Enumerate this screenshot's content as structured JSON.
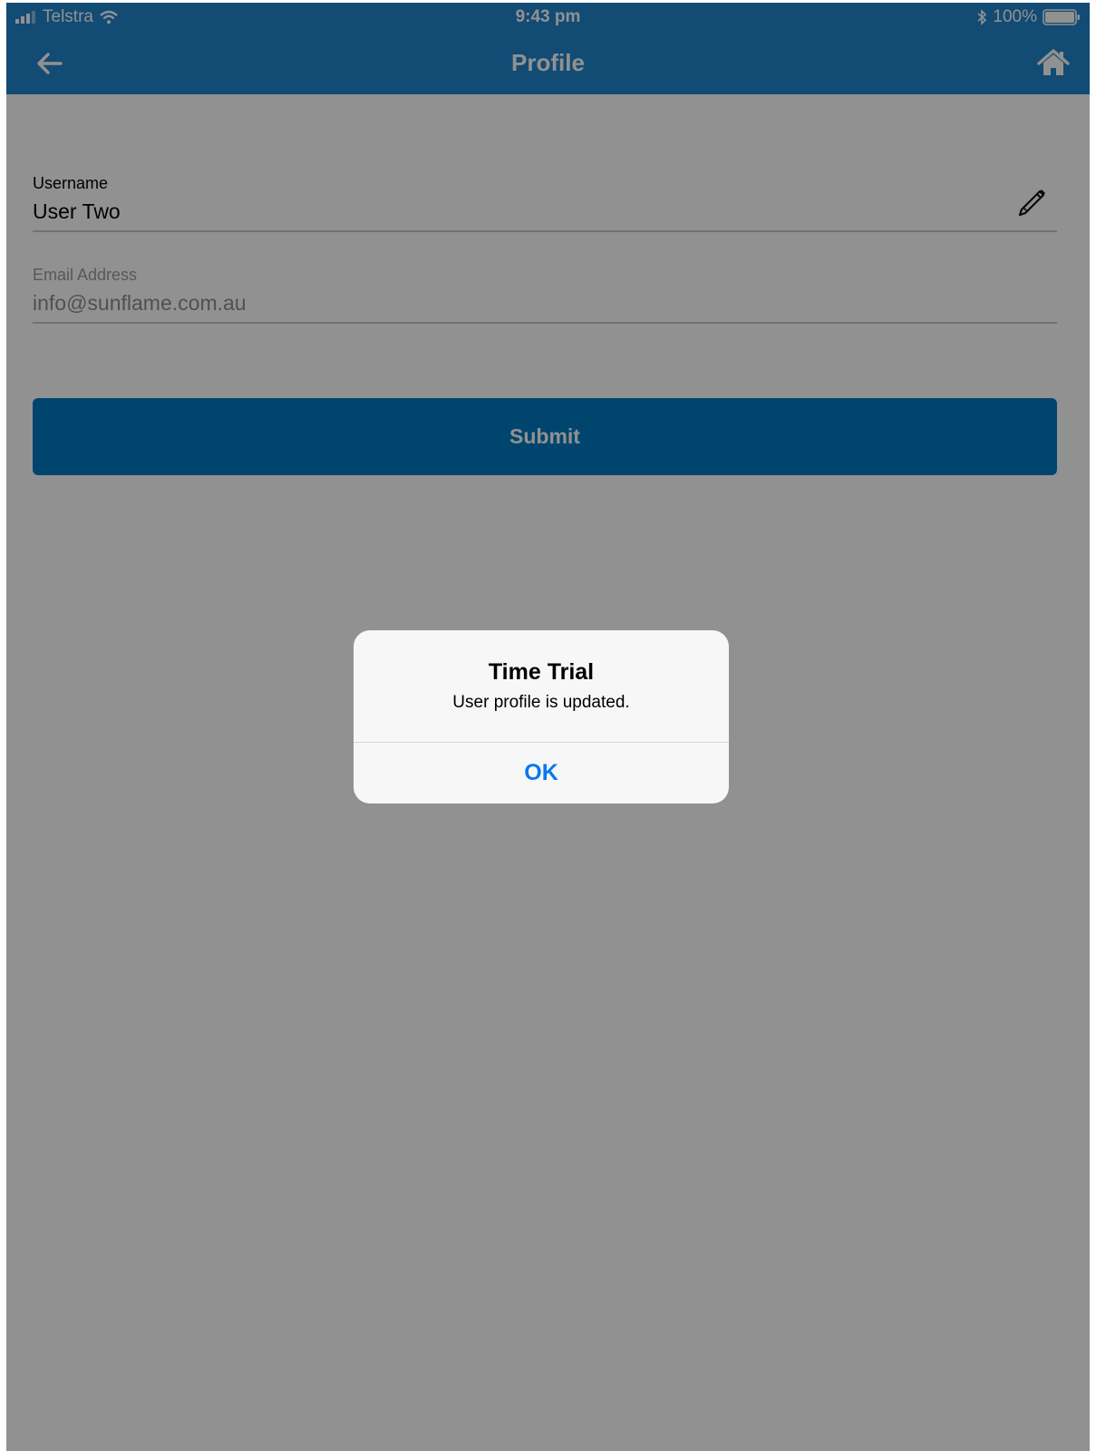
{
  "status_bar": {
    "carrier": "Telstra",
    "time": "9:43 pm",
    "battery": "100%"
  },
  "nav": {
    "title": "Profile",
    "back_icon": "arrow-left-icon",
    "home_icon": "home-icon"
  },
  "form": {
    "username_label": "Username",
    "username_value": "User Two",
    "edit_icon": "pencil-icon",
    "email_label": "Email Address",
    "email_value": "info@sunflame.com.au",
    "submit_label": "Submit"
  },
  "alert": {
    "title": "Time Trial",
    "message": "User profile is updated.",
    "ok_label": "OK"
  },
  "colors": {
    "header": "#2185cc",
    "button": "#007ac0",
    "alert_button": "#0a78f0"
  }
}
